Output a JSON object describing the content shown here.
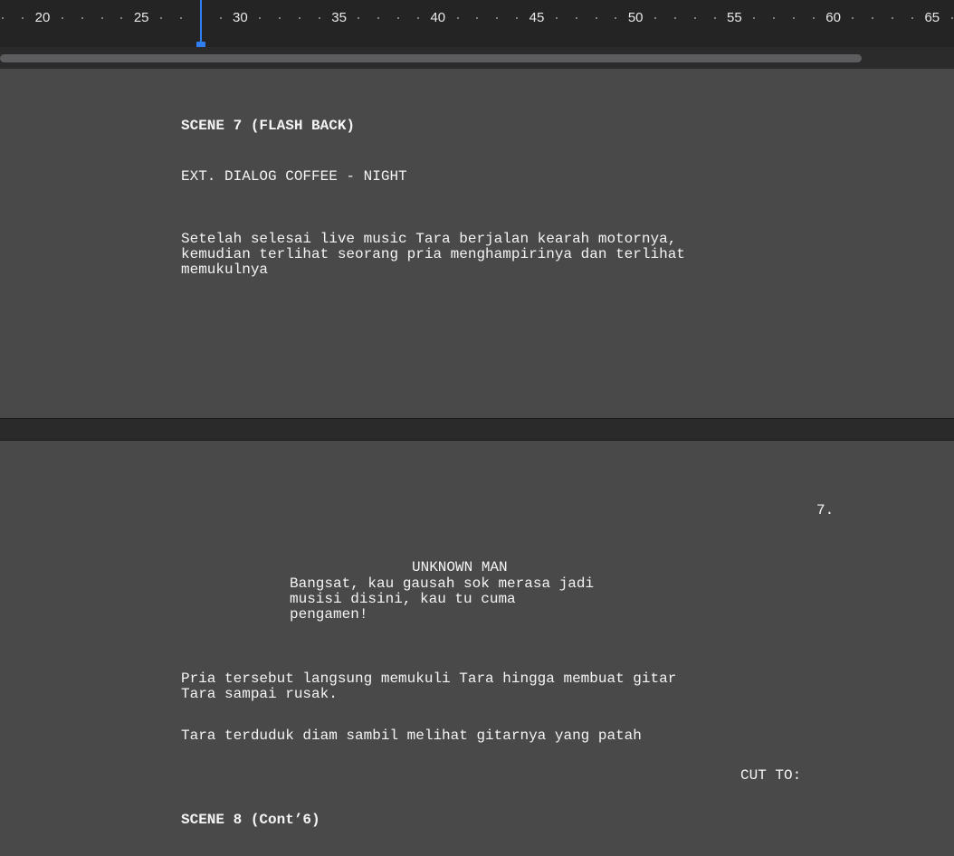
{
  "ruler": {
    "labels": [
      "20",
      "25",
      "30",
      "35",
      "40",
      "45",
      "50",
      "55",
      "60",
      "65"
    ]
  },
  "pages": [
    {
      "scene_heading": "SCENE 7 (FLASH BACK)",
      "slugline": "EXT. DIALOG COFFEE - NIGHT",
      "action": [
        "Setelah selesai live music Tara berjalan kearah motornya,",
        "kemudian terlihat seorang pria menghampirinya dan terlihat",
        "memukulnya"
      ]
    },
    {
      "page_number": "7.",
      "character": "UNKNOWN MAN",
      "dialogue": [
        "Bangsat, kau gausah sok merasa jadi",
        "musisi disini, kau tu cuma",
        "pengamen!"
      ],
      "action_1": [
        "Pria tersebut langsung memukuli Tara hingga membuat gitar",
        "Tara sampai rusak."
      ],
      "action_2": "Tara terduduk diam sambil melihat gitarnya yang patah",
      "transition": "CUT TO:",
      "scene_heading": "SCENE 8 (Cont’6)"
    }
  ]
}
